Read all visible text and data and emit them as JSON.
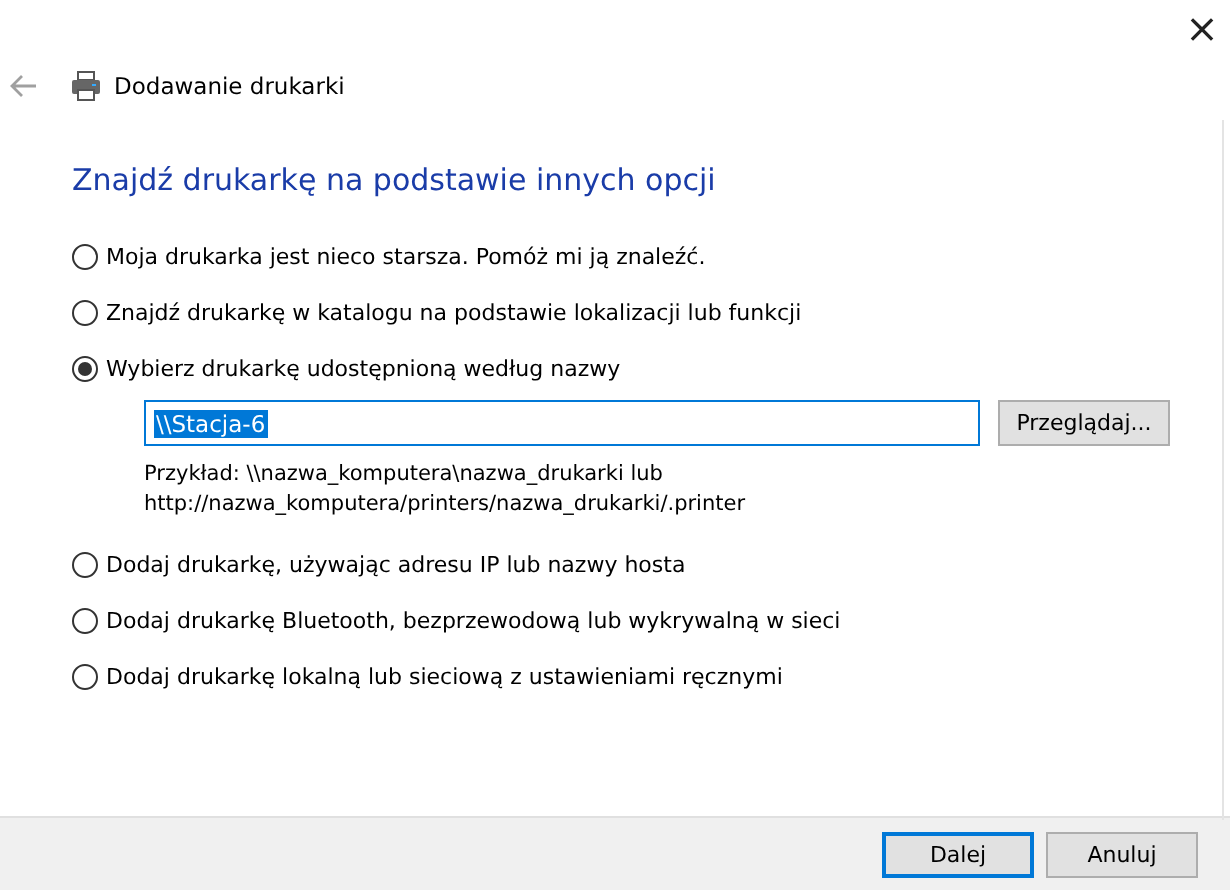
{
  "window": {
    "title": "Dodawanie drukarki",
    "close": "×"
  },
  "heading": "Znajdź drukarkę na podstawie innych opcji",
  "options": [
    {
      "label": "Moja drukarka jest nieco starsza. Pomóż mi ją znaleźć.",
      "selected": false
    },
    {
      "label": "Znajdź drukarkę w katalogu na podstawie lokalizacji lub funkcji",
      "selected": false
    },
    {
      "label": "Wybierz drukarkę udostępnioną według nazwy",
      "selected": true,
      "details": {
        "value": "\\\\Stacja-6",
        "browse_button": "Przeglądaj...",
        "example": [
          "Przykład: \\\\nazwa_komputera\\nazwa_drukarki lub",
          "http://nazwa_komputera/printers/nazwa_drukarki/.printer"
        ]
      }
    },
    {
      "label": "Dodaj drukarkę, używając adresu IP lub nazwy hosta",
      "selected": false
    },
    {
      "label": "Dodaj drukarkę Bluetooth, bezprzewodową lub wykrywalną w sieci",
      "selected": false
    },
    {
      "label": "Dodaj drukarkę lokalną lub sieciową z ustawieniami ręcznymi",
      "selected": false
    }
  ],
  "buttons": [
    {
      "label": "Dalej",
      "default": true
    },
    {
      "label": "Anuluj",
      "default": false
    }
  ]
}
